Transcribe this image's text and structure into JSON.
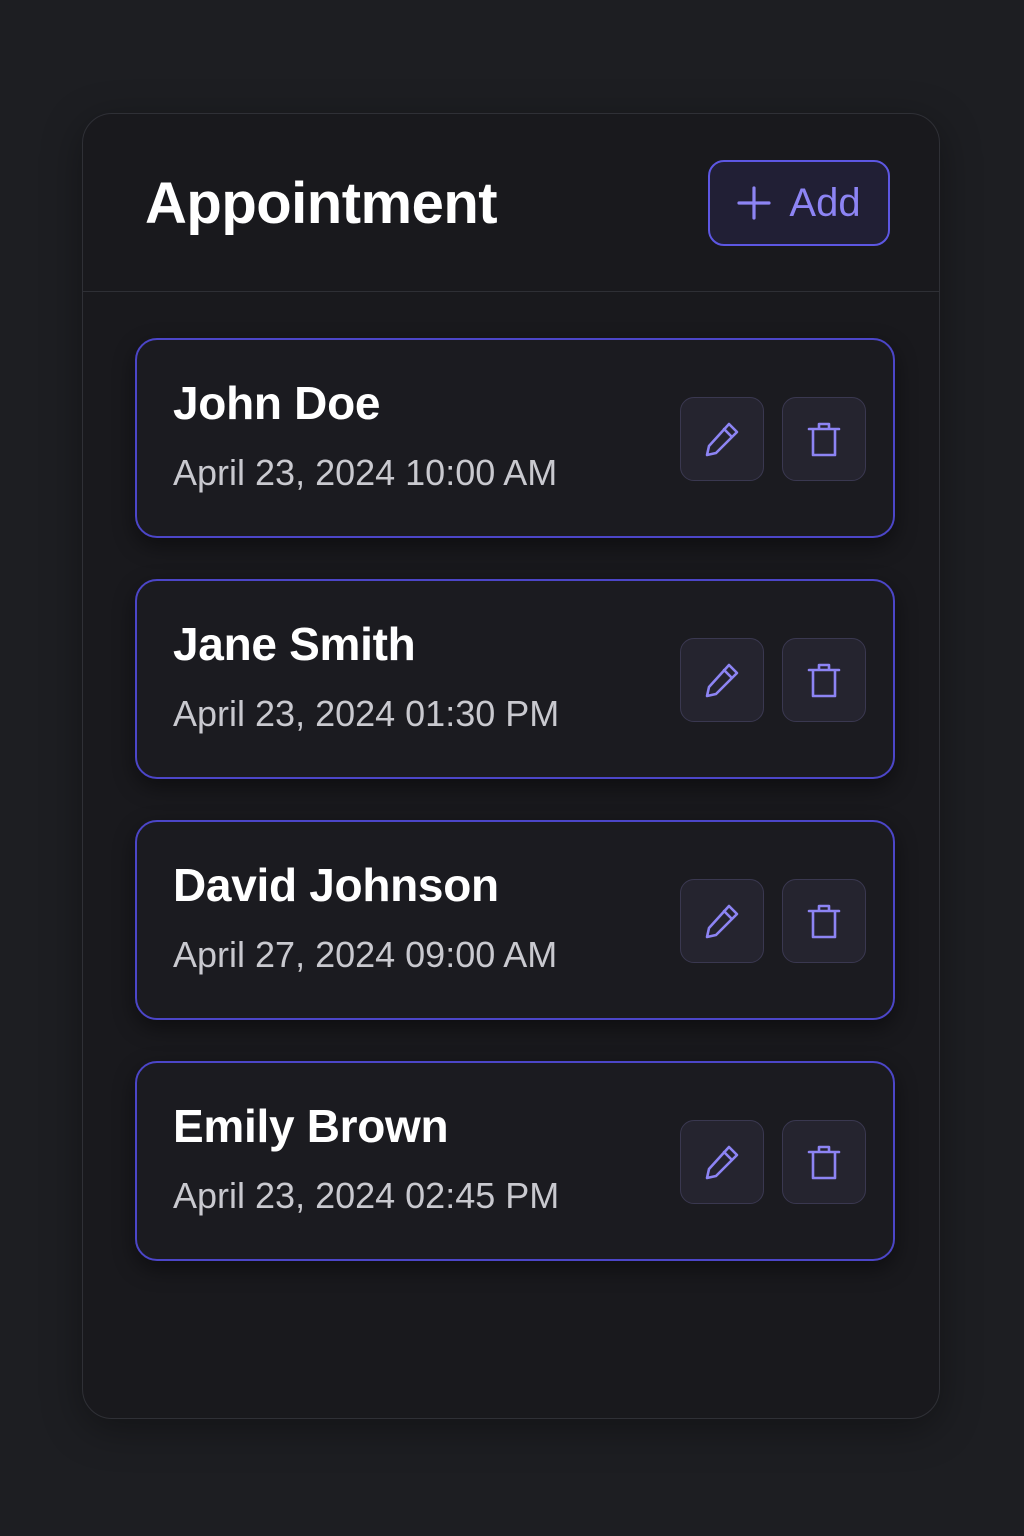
{
  "header": {
    "title": "Appointment",
    "add_label": "Add"
  },
  "appointments": [
    {
      "name": "John Doe",
      "datetime": "April 23, 2024 10:00 AM"
    },
    {
      "name": "Jane Smith",
      "datetime": "April 23, 2024 01:30 PM"
    },
    {
      "name": "David Johnson",
      "datetime": "April 27, 2024 09:00 AM"
    },
    {
      "name": "Emily Brown",
      "datetime": "April 23, 2024 02:45 PM"
    }
  ],
  "icons": {
    "add": "plus-icon",
    "edit": "pencil-icon",
    "delete": "trash-icon"
  },
  "colors": {
    "background": "#1d1e22",
    "panel": "#19191d",
    "accent": "#5d57e3",
    "accent_text": "#8d84f4",
    "text_primary": "#ffffff",
    "text_secondary": "#c9c9cf"
  }
}
